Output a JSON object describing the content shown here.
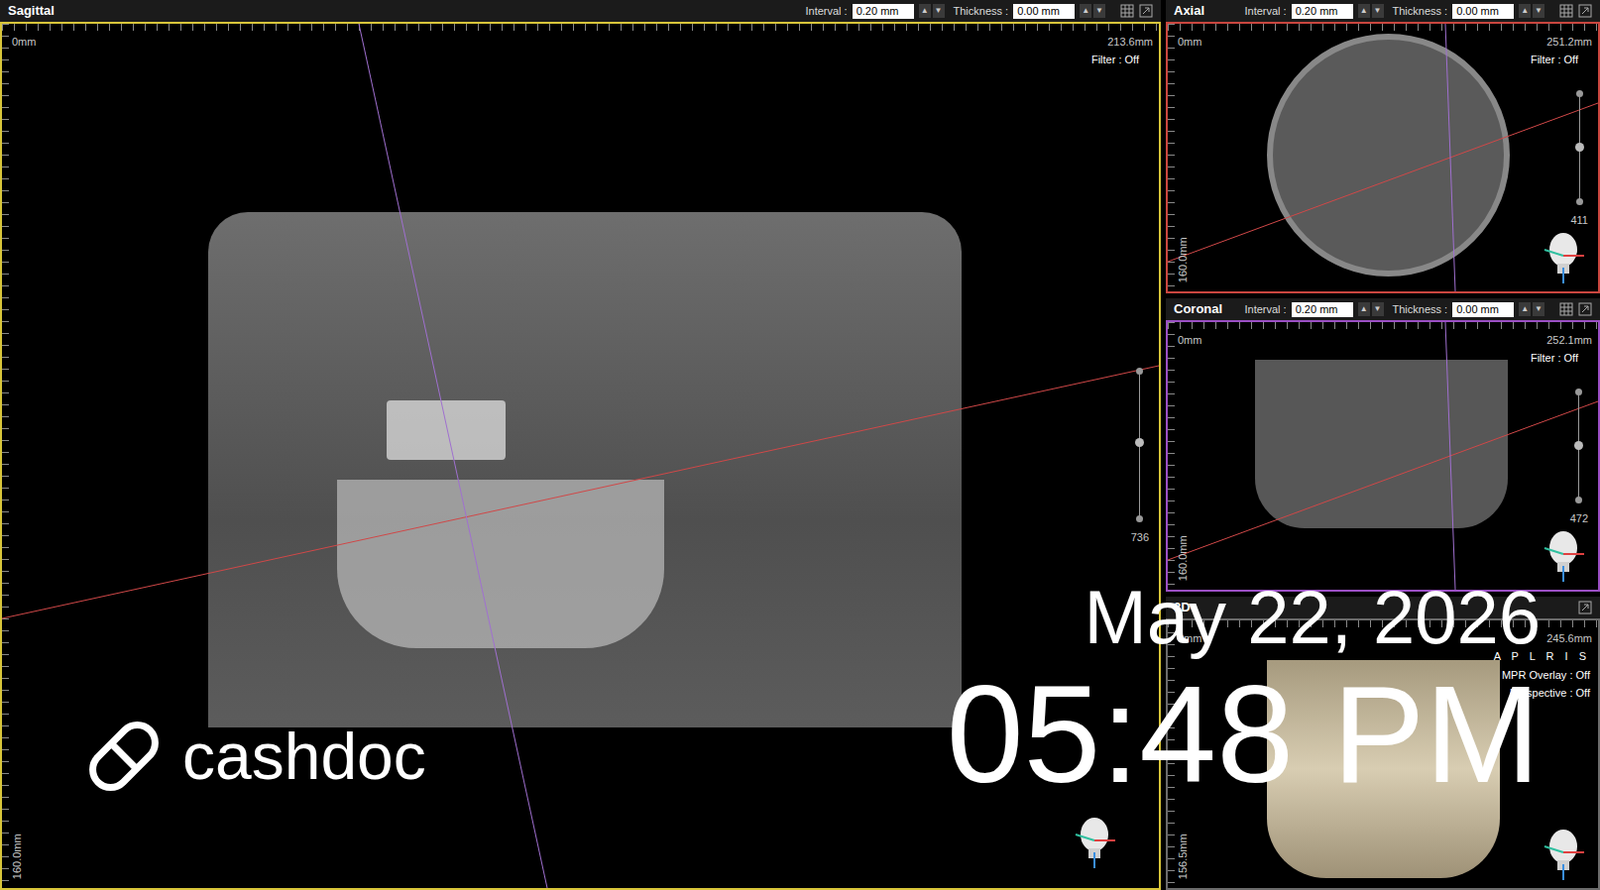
{
  "panels": [
    {
      "title": "Sagittal",
      "kind": "mpr",
      "color": "#d8c53a",
      "interval_label": "Interval :",
      "interval": "0.20 mm",
      "thickness_label": "Thickness :",
      "thickness": "0.00 mm",
      "up": "▲",
      "down": "▼",
      "origin": "0mm",
      "extent": "213.6mm",
      "filter": "Filter : Off",
      "depth": "160.0mm",
      "slice": "736"
    },
    {
      "title": "Axial",
      "kind": "mpr",
      "color": "#c9463f",
      "interval_label": "Interval :",
      "interval": "0.20 mm",
      "thickness_label": "Thickness :",
      "thickness": "0.00 mm",
      "up": "▲",
      "down": "▼",
      "origin": "0mm",
      "extent": "251.2mm",
      "filter": "Filter : Off",
      "depth": "160.0mm",
      "slice": "411"
    },
    {
      "title": "Coronal",
      "kind": "mpr",
      "color": "#9b4fc4",
      "interval_label": "Interval :",
      "interval": "0.20 mm",
      "thickness_label": "Thickness :",
      "thickness": "0.00 mm",
      "up": "▲",
      "down": "▼",
      "origin": "0mm",
      "extent": "252.1mm",
      "filter": "Filter : Off",
      "depth": "160.0mm",
      "slice": "472"
    },
    {
      "title": "3D",
      "kind": "3d",
      "color": "#6b6b6b",
      "origin": "0mm",
      "extent": "245.6mm",
      "orientation": "A P L R I S",
      "mpr_overlay": "MPR Overlay : Off",
      "perspective": "Perspective : Off",
      "depth": "156.5mm"
    }
  ],
  "overlay": {
    "date": "May 22, 2026",
    "time": "05:48 PM",
    "logo": "cashdoc"
  }
}
